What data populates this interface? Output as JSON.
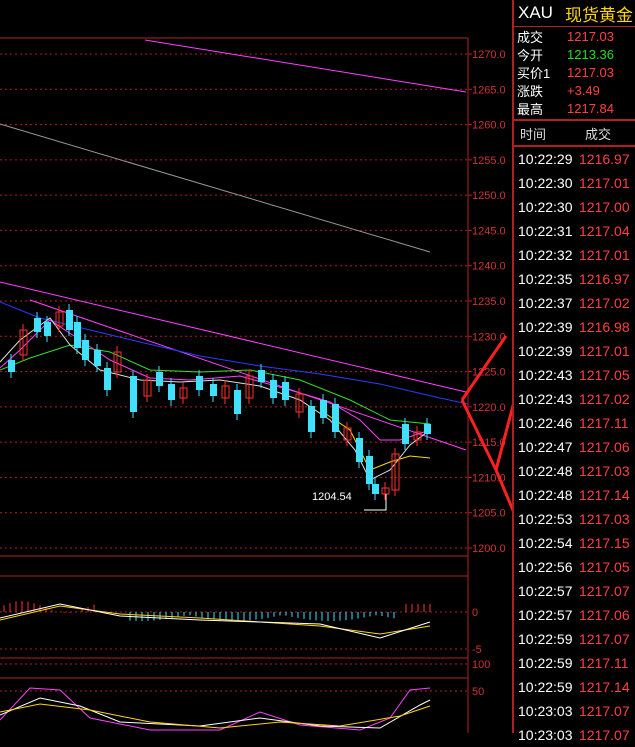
{
  "quote": {
    "symbol": "XAU",
    "name": "现货黄金",
    "rows": [
      {
        "label": "成交",
        "value": "1217.03",
        "color": "red"
      },
      {
        "label": "今开",
        "value": "1213.36",
        "color": "green"
      },
      {
        "label": "买价1",
        "value": "1217.03",
        "color": "red"
      },
      {
        "label": "涨跌",
        "value": "+3.49",
        "color": "red"
      },
      {
        "label": "最高",
        "value": "1217.84",
        "color": "red"
      }
    ]
  },
  "trades": {
    "header_time": "时间",
    "header_price": "成交",
    "rows": [
      {
        "time": "10:22:29",
        "price": "1216.97"
      },
      {
        "time": "10:22:30",
        "price": "1217.01"
      },
      {
        "time": "10:22:30",
        "price": "1217.00"
      },
      {
        "time": "10:22:31",
        "price": "1217.04"
      },
      {
        "time": "10:22:32",
        "price": "1217.01"
      },
      {
        "time": "10:22:35",
        "price": "1216.97"
      },
      {
        "time": "10:22:37",
        "price": "1217.02"
      },
      {
        "time": "10:22:39",
        "price": "1216.98"
      },
      {
        "time": "10:22:39",
        "price": "1217.01"
      },
      {
        "time": "10:22:43",
        "price": "1217.05"
      },
      {
        "time": "10:22:43",
        "price": "1217.02"
      },
      {
        "time": "10:22:46",
        "price": "1217.11"
      },
      {
        "time": "10:22:47",
        "price": "1217.06"
      },
      {
        "time": "10:22:48",
        "price": "1217.03"
      },
      {
        "time": "10:22:48",
        "price": "1217.14"
      },
      {
        "time": "10:22:53",
        "price": "1217.03"
      },
      {
        "time": "10:22:54",
        "price": "1217.15"
      },
      {
        "time": "10:22:56",
        "price": "1217.05"
      },
      {
        "time": "10:22:57",
        "price": "1217.07"
      },
      {
        "time": "10:22:57",
        "price": "1217.06"
      },
      {
        "time": "10:22:59",
        "price": "1217.07"
      },
      {
        "time": "10:22:59",
        "price": "1217.11"
      },
      {
        "time": "10:22:59",
        "price": "1217.14"
      },
      {
        "time": "10:23:03",
        "price": "1217.07"
      },
      {
        "time": "10:23:03",
        "price": "1217.07"
      }
    ]
  },
  "price_axis": [
    "1270.0",
    "1265.0",
    "1260.0",
    "1255.0",
    "1250.0",
    "1245.0",
    "1240.0",
    "1235.0",
    "1230.0",
    "1225.0",
    "1220.0",
    "1215.0",
    "1210.0",
    "1205.0",
    "1200.0"
  ],
  "macd_axis": [
    "0",
    "-5"
  ],
  "kdj_axis": [
    "100",
    "50"
  ],
  "low_marker": "1204.54",
  "colors": {
    "up": "#ff3030",
    "down": "#40e0ff",
    "grid": "#b02020",
    "trendline": "#ff40ff"
  }
}
